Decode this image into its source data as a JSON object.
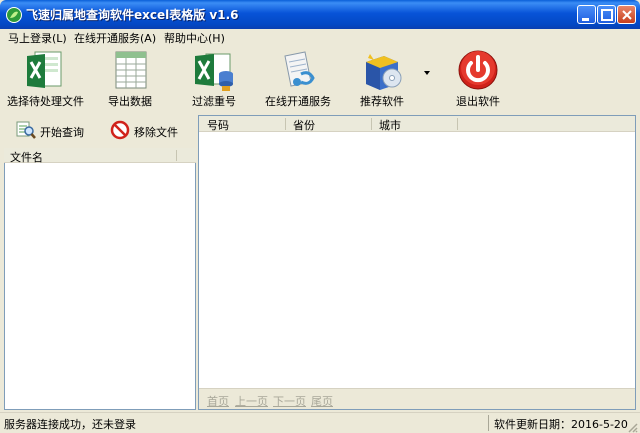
{
  "window": {
    "title": "飞速归属地查询软件excel表格版 v1.6",
    "icon": "app-leaf-icon"
  },
  "menu": [
    {
      "label": "马上登录(L)"
    },
    {
      "label": "在线开通服务(A)"
    },
    {
      "label": "帮助中心(H)"
    }
  ],
  "toolbar": {
    "items": [
      {
        "label": "选择待处理文件",
        "icon": "excel-file-icon"
      },
      {
        "label": "导出数据",
        "icon": "spreadsheet-icon"
      },
      {
        "label": "过滤重号",
        "icon": "excel-filter-icon"
      },
      {
        "label": "在线开通服务",
        "icon": "online-service-icon"
      },
      {
        "label": "推荐软件",
        "icon": "software-box-icon"
      },
      {
        "label": "退出软件",
        "icon": "power-icon"
      }
    ]
  },
  "left_panel": {
    "start_query_label": "开始查询",
    "remove_file_label": "移除文件",
    "file_column_header": "文件名"
  },
  "grid": {
    "columns": [
      "号码",
      "省份",
      "城市"
    ],
    "rows": []
  },
  "pager": {
    "first": "首页",
    "prev": "上一页",
    "next": "下一页",
    "last": "尾页"
  },
  "status": {
    "connection": "服务器连接成功，还未登录",
    "update_date": "软件更新日期：2016-5-20"
  },
  "colors": {
    "titlebar": "#0854d8",
    "window_bg": "#ece9d8",
    "excel_green": "#1e7b3c",
    "exit_red": "#d0221a"
  }
}
